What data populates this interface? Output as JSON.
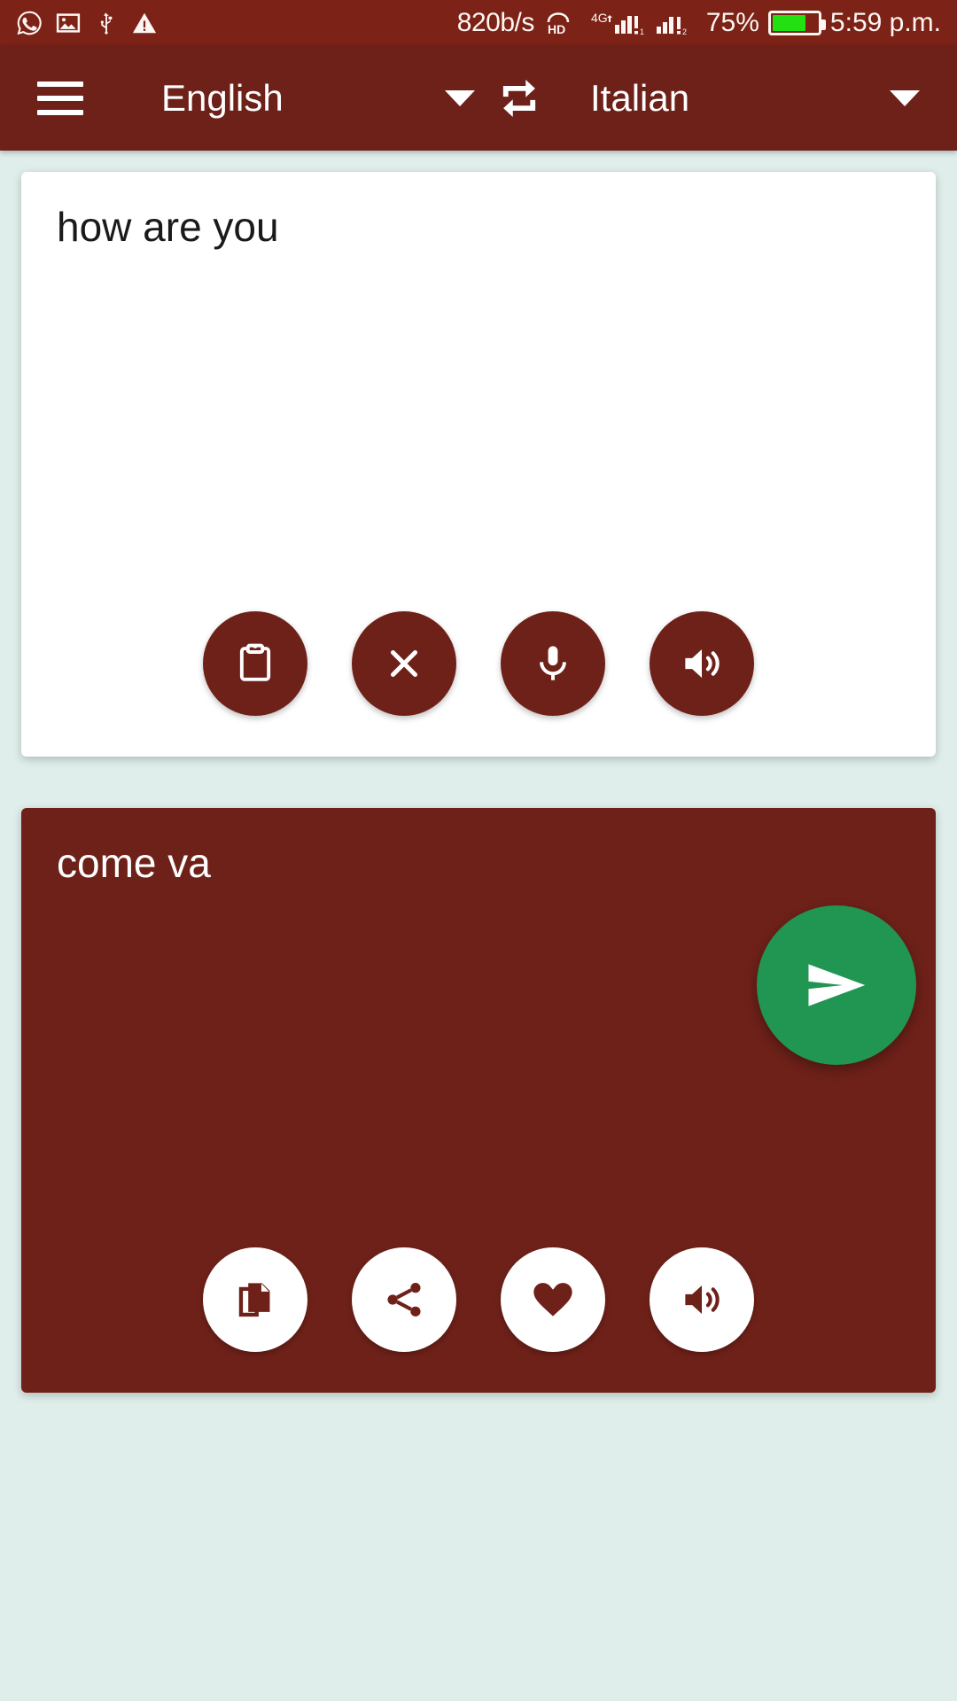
{
  "status_bar": {
    "left_icons": [
      "whatsapp-icon",
      "image-icon",
      "usb-icon",
      "warning-icon"
    ],
    "network_speed": "820b/s",
    "hd_label": "HD",
    "network_type": "4G",
    "battery_percent": "75%",
    "time": "5:59 p.m.",
    "colors": {
      "background": "#7c2217",
      "foreground": "#fdf6f2",
      "battery_fill": "#22e012"
    }
  },
  "app_bar": {
    "menu_icon": "hamburger-menu-icon",
    "source_language": "English",
    "target_language": "Italian",
    "swap_icon": "swap-languages-icon",
    "background": "#6e2119"
  },
  "input_card": {
    "text": "how are you",
    "buttons": [
      {
        "name": "paste-button",
        "icon": "clipboard-icon"
      },
      {
        "name": "clear-button",
        "icon": "close-x-icon"
      },
      {
        "name": "voice-input-button",
        "icon": "microphone-icon"
      },
      {
        "name": "speak-source-button",
        "icon": "speaker-icon"
      }
    ],
    "background": "#ffffff"
  },
  "send_button": {
    "name": "send-translate-button",
    "icon": "send-paper-plane-icon",
    "color": "#219653"
  },
  "output_card": {
    "text": "come va",
    "buttons": [
      {
        "name": "copy-button",
        "icon": "copy-documents-icon"
      },
      {
        "name": "share-button",
        "icon": "share-nodes-icon"
      },
      {
        "name": "favorite-button",
        "icon": "heart-icon"
      },
      {
        "name": "speak-target-button",
        "icon": "speaker-icon"
      }
    ],
    "background": "#6e2119"
  },
  "page": {
    "background": "#dfeeeb"
  }
}
